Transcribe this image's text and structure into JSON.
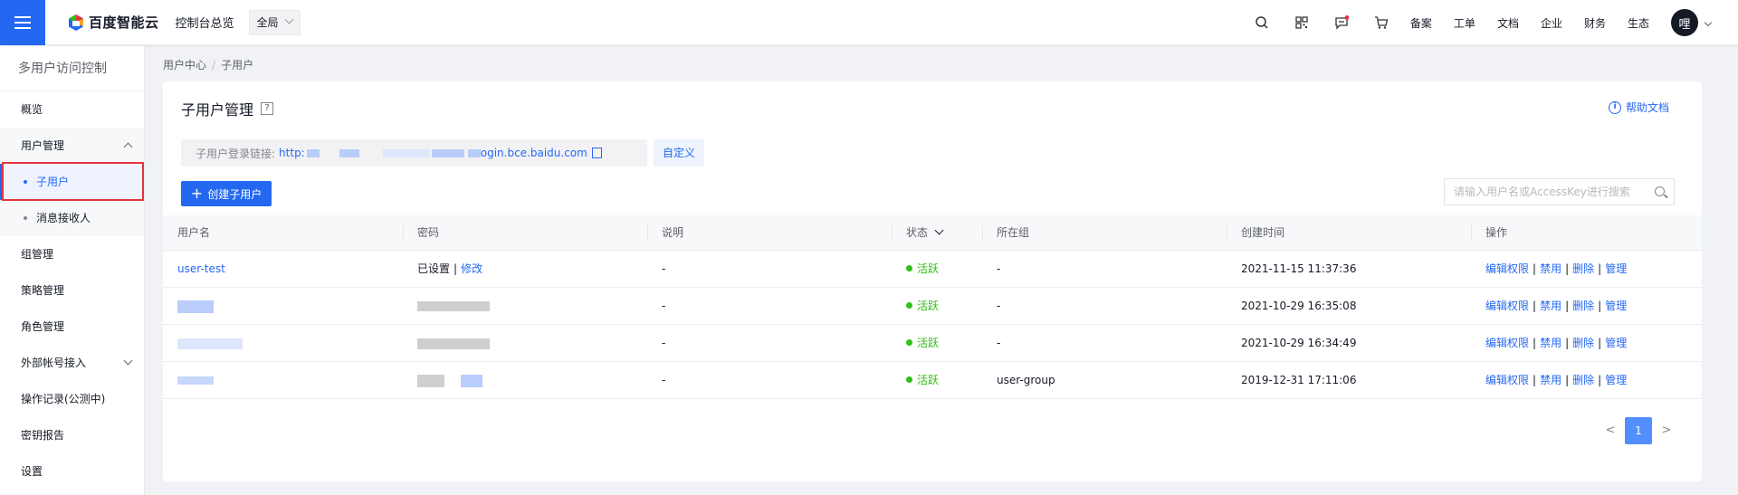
{
  "topbar": {
    "logo_text": "百度智能云",
    "console_label": "控制台总览",
    "region_label": "全局",
    "links": [
      "备案",
      "工单",
      "文档",
      "企业",
      "财务",
      "生态"
    ],
    "avatar_text": "哩"
  },
  "sidebar": {
    "title": "多用户访问控制",
    "items": {
      "overview": "概览",
      "user_management": "用户管理",
      "sub_user": "子用户",
      "message_receiver": "消息接收人",
      "group_management": "组管理",
      "policy_management": "策略管理",
      "role_management": "角色管理",
      "external_account": "外部帐号接入",
      "operation_log": "操作记录(公测中)",
      "key_report": "密钥报告",
      "settings": "设置"
    }
  },
  "breadcrumb": {
    "parent": "用户中心",
    "sep": "/",
    "current": "子用户"
  },
  "main": {
    "title": "子用户管理",
    "help_icon": "?",
    "help_doc": "帮助文档",
    "login_label": "子用户登录链接:",
    "login_url_prefix": "http:",
    "login_url_suffix": "ogin.bce.baidu.com",
    "customize_label": "自定义",
    "create_button": "创建子用户",
    "search_placeholder": "请输入用户名或AccessKey进行搜索"
  },
  "table": {
    "headers": {
      "username": "用户名",
      "password": "密码",
      "description": "说明",
      "status": "状态",
      "group": "所在组",
      "created": "创建时间",
      "actions": "操作"
    },
    "rows": [
      {
        "username": "user-test",
        "password_set": "已设置",
        "password_pipe": "|",
        "password_edit": "修改",
        "description": "-",
        "status": "活跃",
        "group": "-",
        "created": "2021-11-15 11:37:36"
      },
      {
        "description": "-",
        "status": "活跃",
        "group": "-",
        "created": "2021-10-29 16:35:08"
      },
      {
        "description": "-",
        "status": "活跃",
        "group": "-",
        "created": "2021-10-29 16:34:49"
      },
      {
        "description": "-",
        "status": "活跃",
        "group": "user-group",
        "created": "2019-12-31 17:11:06"
      }
    ],
    "actions": {
      "edit_permission": "编辑权限",
      "disable": "禁用",
      "delete": "删除",
      "manage": "管理",
      "pipe": "|"
    }
  },
  "pagination": {
    "prev": "<",
    "current_page": "1",
    "next": ">"
  },
  "colors": {
    "primary": "#2468f2",
    "active_status": "#30bf13",
    "highlight_box": "#e5343e"
  }
}
